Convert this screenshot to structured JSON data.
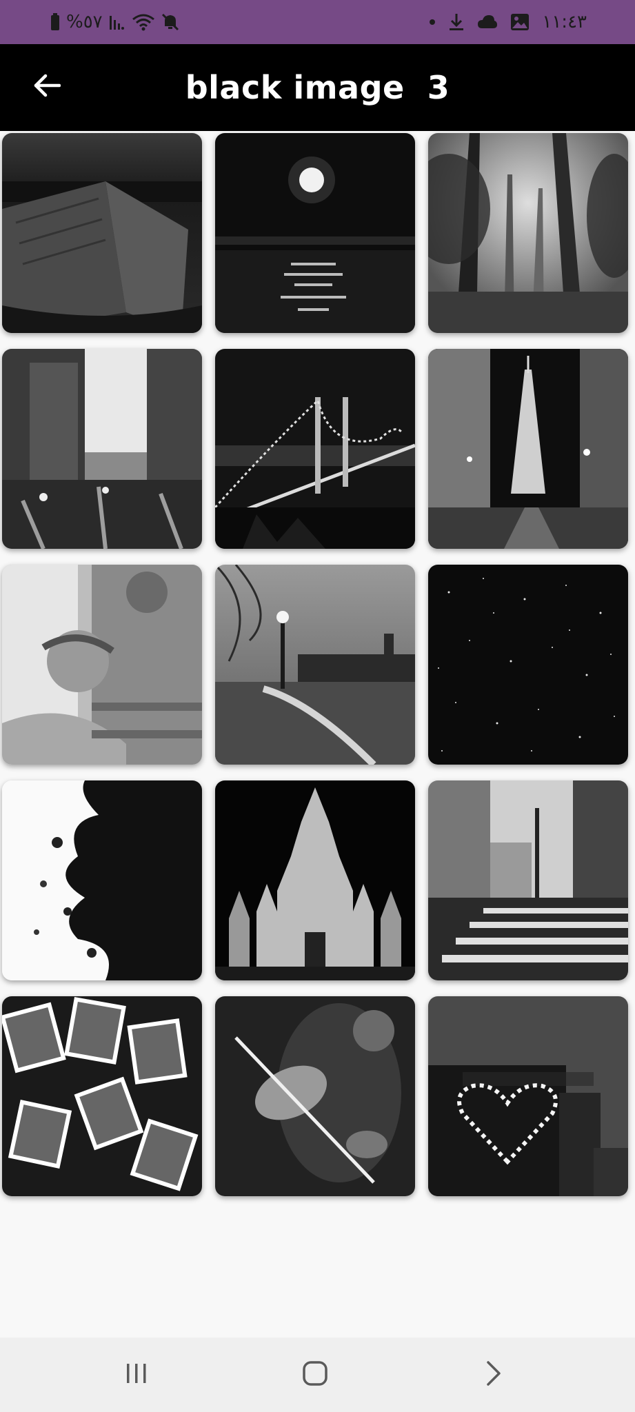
{
  "status_bar": {
    "battery_text": "%٥٧",
    "time": "١١:٤٣",
    "bg_color": "#764a86",
    "icons": [
      "battery-icon",
      "signal-icon",
      "wifi-icon",
      "mute-icon",
      "dot-icon",
      "download-icon",
      "cloud-icon",
      "gallery-icon"
    ]
  },
  "app_bar": {
    "title": "black image  3",
    "back_icon": "arrow-left-icon",
    "bg_color": "#000000"
  },
  "gallery": {
    "images": [
      {
        "name": "open-book-image"
      },
      {
        "name": "moon-over-sea-image"
      },
      {
        "name": "misty-forest-image"
      },
      {
        "name": "rainy-city-street-image"
      },
      {
        "name": "night-bridge-image"
      },
      {
        "name": "eiffel-tower-street-image"
      },
      {
        "name": "angel-statue-image"
      },
      {
        "name": "london-riverside-image"
      },
      {
        "name": "starry-sky-image"
      },
      {
        "name": "ink-splash-image"
      },
      {
        "name": "castle-at-night-image"
      },
      {
        "name": "crosswalk-city-image"
      },
      {
        "name": "scattered-polaroids-image"
      },
      {
        "name": "violinist-image"
      },
      {
        "name": "heart-building-image"
      }
    ]
  },
  "nav_bar": {
    "buttons": [
      "recents-icon",
      "home-icon",
      "back-chevron-icon"
    ]
  }
}
